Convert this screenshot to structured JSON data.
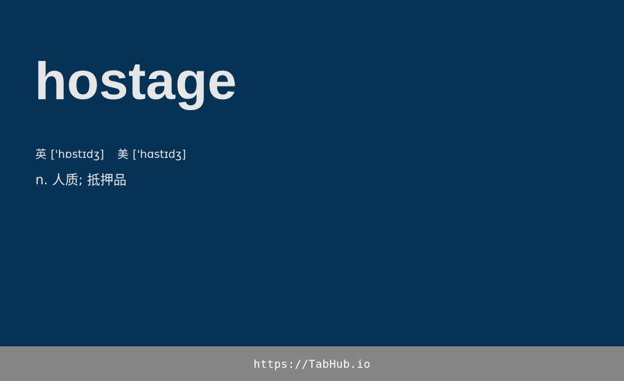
{
  "card": {
    "word": "hostage",
    "phonetics": {
      "uk_label": "英",
      "uk_ipa": "['hɒstɪdʒ]",
      "us_label": "美",
      "us_ipa": "['hɑstɪdʒ]"
    },
    "definition": {
      "part_of_speech": "n.",
      "meaning": "人质; 抵押品"
    }
  },
  "footer": {
    "link_text": "https://TabHub.io"
  },
  "colors": {
    "background": "#063255",
    "text": "#e6e6e6",
    "footer_background": "#858585",
    "footer_text": "#ffffff"
  }
}
